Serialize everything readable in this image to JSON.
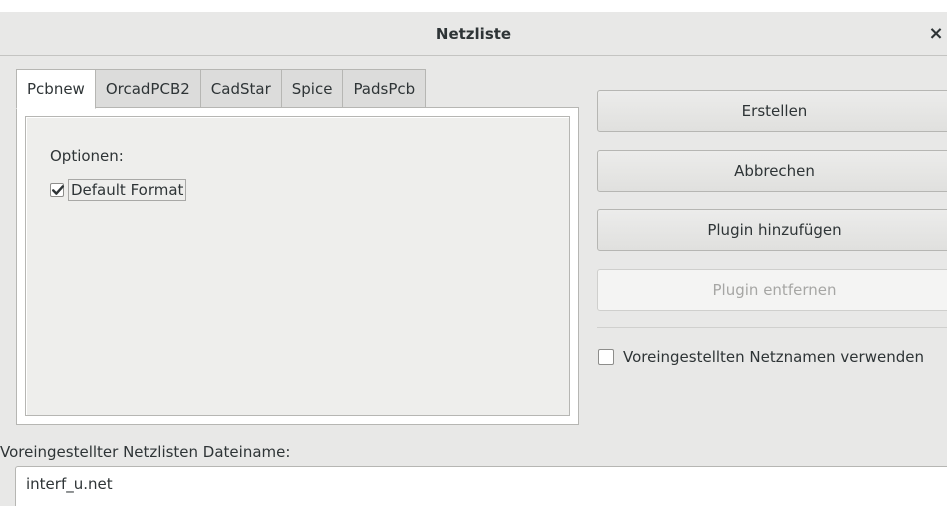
{
  "window": {
    "title": "Netzliste",
    "close_glyph": "×"
  },
  "tabs": [
    {
      "label": "Pcbnew",
      "active": true
    },
    {
      "label": "OrcadPCB2",
      "active": false
    },
    {
      "label": "CadStar",
      "active": false
    },
    {
      "label": "Spice",
      "active": false
    },
    {
      "label": "PadsPcb",
      "active": false
    }
  ],
  "panel": {
    "options_label": "Optionen:",
    "default_format": {
      "label": "Default Format",
      "checked": true
    }
  },
  "buttons": {
    "create": "Erstellen",
    "cancel": "Abbrechen",
    "add_plugin": "Plugin hinzufügen",
    "remove_plugin": "Plugin entfernen"
  },
  "use_default_netnames": {
    "label": "Voreingestellten Netznamen verwenden",
    "checked": false
  },
  "filename": {
    "label": "Voreingestellter Netzlisten Dateiname:",
    "value": "interf_u.net"
  },
  "icons": {
    "close": "close-icon",
    "check": "checkmark-icon"
  }
}
